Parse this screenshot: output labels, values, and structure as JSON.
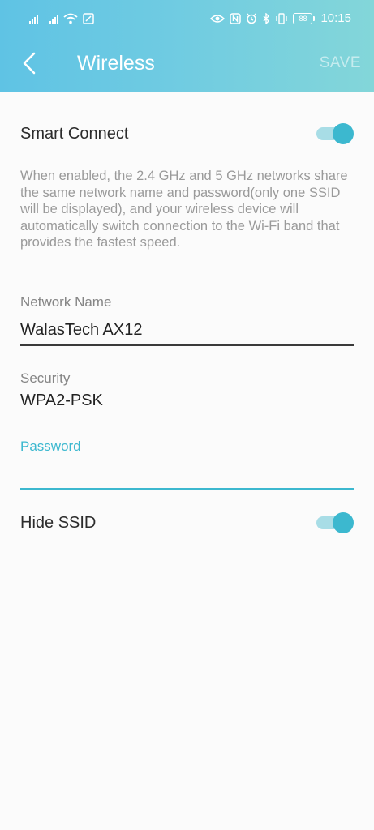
{
  "status_bar": {
    "time": "10:15",
    "battery": "88",
    "icons": [
      "signal-icon",
      "signal-icon",
      "wifi-icon",
      "screenshot-icon",
      "eye-icon",
      "nfc-icon",
      "alarm-icon",
      "bluetooth-icon",
      "vibrate-icon",
      "battery-icon"
    ]
  },
  "app_bar": {
    "title": "Wireless",
    "save_label": "SAVE",
    "back_icon": "chevron-left-icon"
  },
  "smart_connect": {
    "label": "Smart Connect",
    "enabled": true,
    "description": "When enabled, the 2.4 GHz and 5 GHz networks share the same network name and password(only one SSID will be displayed), and your wireless device will automatically switch connection to the Wi-Fi band that provides the fastest speed."
  },
  "network_name": {
    "label": "Network Name",
    "value": "WalasTech AX12"
  },
  "security": {
    "label": "Security",
    "value": "WPA2-PSK"
  },
  "password": {
    "label": "Password",
    "value": ""
  },
  "hide_ssid": {
    "label": "Hide SSID",
    "enabled": true
  },
  "colors": {
    "header_start": "#5fc3e4",
    "header_end": "#83d6d9",
    "accent": "#3cb8cf",
    "toggle_track": "#a8dde6",
    "background": "#fbfbfb"
  }
}
